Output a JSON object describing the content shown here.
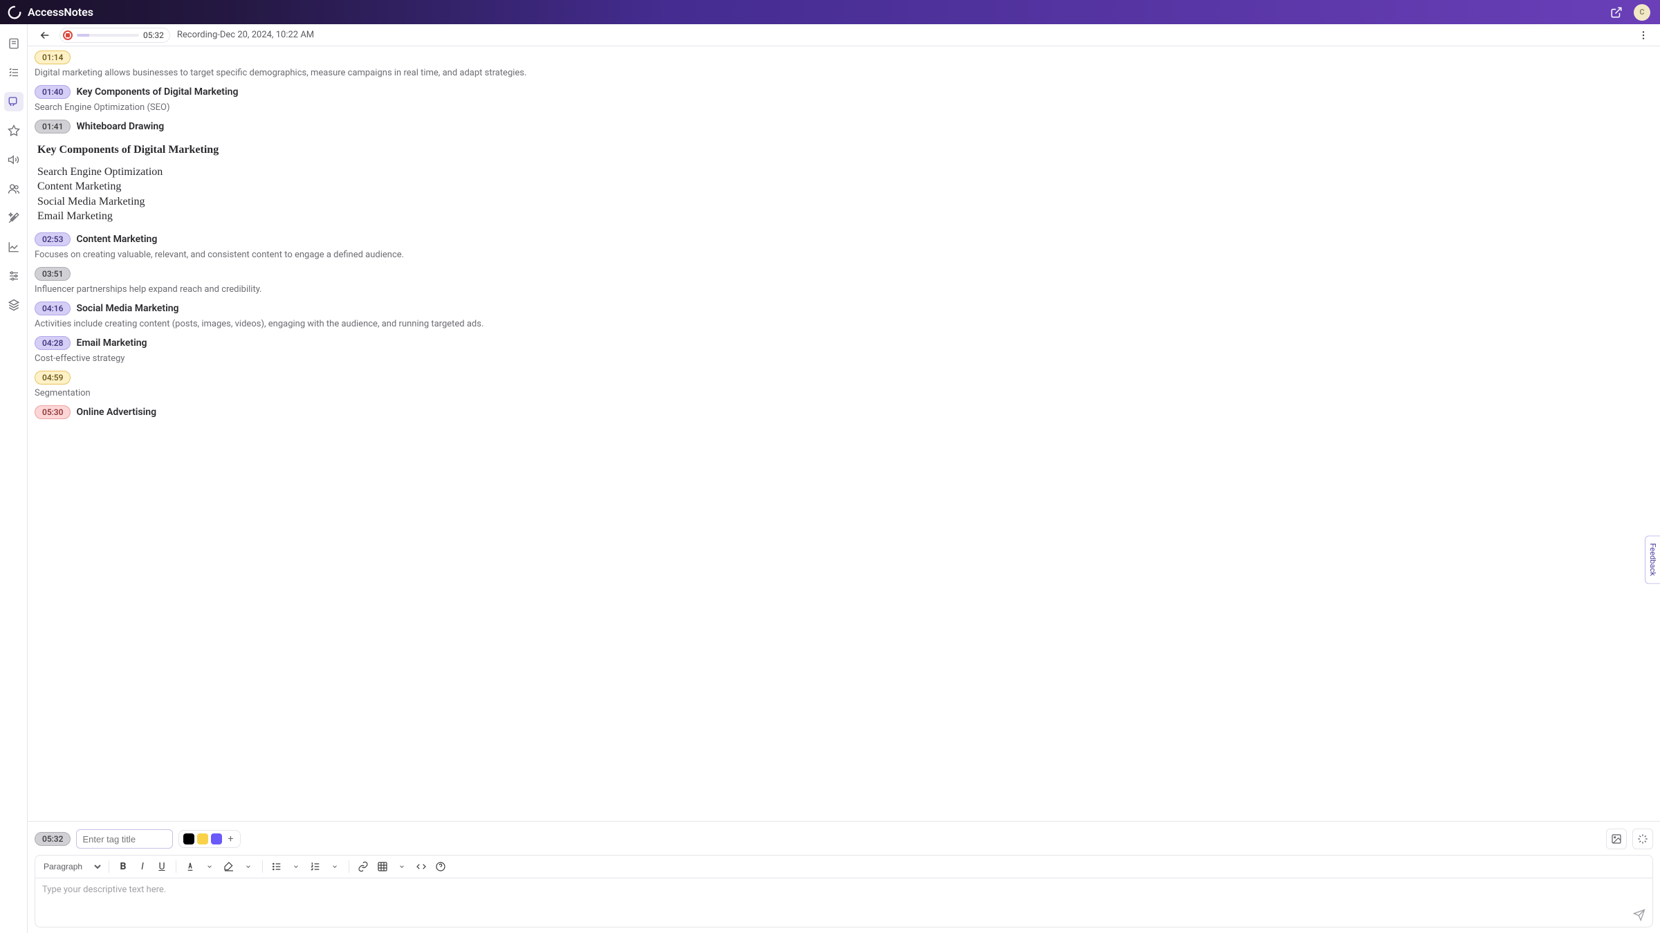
{
  "brand": "AccessNotes",
  "avatar_initial": "C",
  "recording": {
    "time": "05:32",
    "title": "Recording-Dec 20, 2024, 10:22 AM"
  },
  "entries": [
    {
      "ts": "01:14",
      "color": "yellow",
      "title": "",
      "body": "Digital marketing allows businesses to target specific demographics, measure campaigns in real time, and adapt strategies."
    },
    {
      "ts": "01:40",
      "color": "lavender",
      "title": "Key Components of Digital Marketing",
      "body": "Search Engine Optimization (SEO)"
    },
    {
      "ts": "01:41",
      "color": "grey",
      "title": "Whiteboard Drawing",
      "whiteboard": {
        "heading": "Key Components of Digital Marketing",
        "lines": [
          "Search Engine Optimization",
          "Content Marketing",
          "Social Media Marketing",
          "Email Marketing"
        ]
      }
    },
    {
      "ts": "02:53",
      "color": "lavender",
      "title": "Content Marketing",
      "body": "Focuses on creating valuable, relevant, and consistent content to engage a defined audience."
    },
    {
      "ts": "03:51",
      "color": "grey",
      "title": "",
      "body": "Influencer partnerships help expand reach and credibility."
    },
    {
      "ts": "04:16",
      "color": "lavender",
      "title": "Social Media Marketing",
      "body": "Activities include creating content (posts, images, videos), engaging with the audience, and running targeted ads."
    },
    {
      "ts": "04:28",
      "color": "lavender",
      "title": "Email Marketing",
      "body": "Cost-effective strategy"
    },
    {
      "ts": "04:59",
      "color": "yellow",
      "title": "",
      "body": "Segmentation"
    },
    {
      "ts": "05:30",
      "color": "red",
      "title": "Online Advertising",
      "body": ""
    }
  ],
  "compose": {
    "current_ts": "05:32",
    "tag_placeholder": "Enter tag title",
    "para_label": "Paragraph",
    "editor_placeholder": "Type your descriptive text here."
  },
  "feedback_label": "Feedback"
}
